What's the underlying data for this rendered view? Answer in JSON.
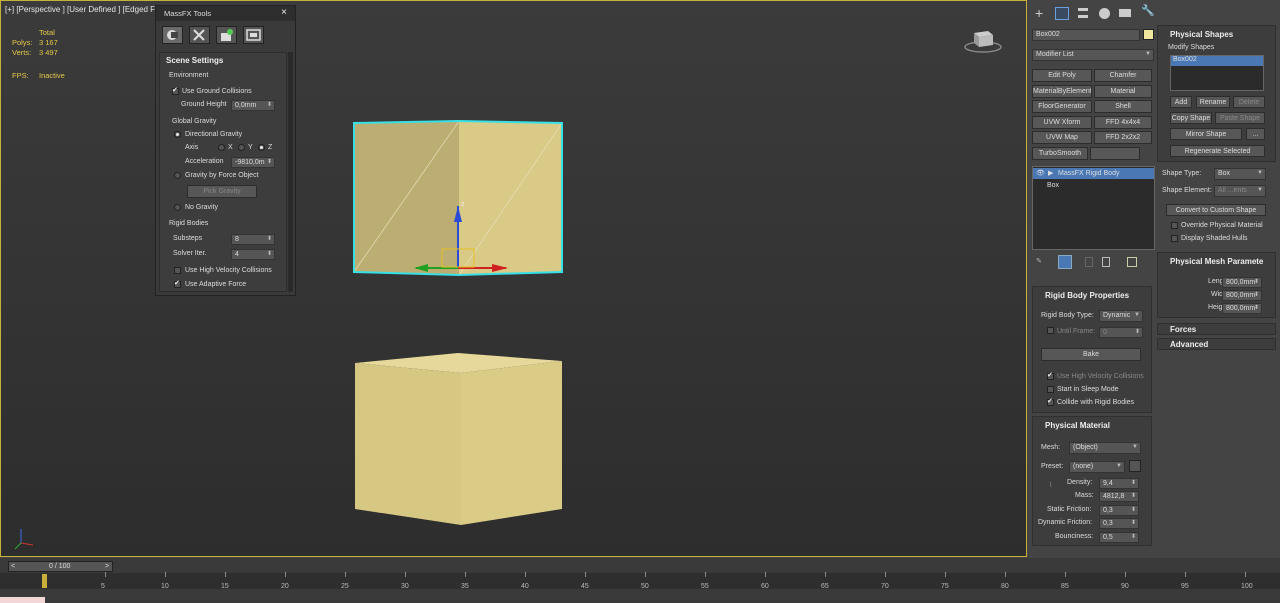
{
  "viewport": {
    "label": "[+] [Perspective ] [User Defined ] [Edged Fa",
    "stats": {
      "total_label": "Total",
      "polys_label": "Polys:",
      "polys_value": "3 167",
      "verts_label": "Verts:",
      "verts_value": "3 497",
      "fps_label": "FPS:",
      "fps_value": "Inactive"
    },
    "gizmo_axis_label": "z"
  },
  "massfx": {
    "title": "MassFX Tools",
    "close": "×",
    "tabs": [
      "world-icon",
      "tools-icon",
      "simulation-icon",
      "display-icon"
    ],
    "section": "Scene Settings",
    "environment_label": "Environment",
    "use_ground_collisions": "Use Ground Collisions",
    "ground_height_label": "Ground Height",
    "ground_height_value": "0,0mm",
    "global_gravity_label": "Global Gravity",
    "directional_gravity": "Directional Gravity",
    "axis_label": "Axis",
    "axis_x": "X",
    "axis_y": "Y",
    "axis_z": "Z",
    "acceleration_label": "Acceleration",
    "acceleration_value": "-9810,0m",
    "gravity_by_force": "Gravity by Force Object",
    "pick_gravity": "Pick Gravity",
    "no_gravity": "No Gravity",
    "rigid_bodies_label": "Rigid Bodies",
    "substeps_label": "Substeps",
    "substeps_value": "8",
    "solver_label": "Solver Iter.",
    "solver_value": "4",
    "high_velocity": "Use High Velocity Collisions",
    "adaptive_force": "Use Adaptive Force"
  },
  "cmd": {
    "object_name": "Box002",
    "modifier_list": "Modifier List",
    "mod_buttons": [
      "Edit Poly",
      "Chamfer",
      "MaterialByElement",
      "Material",
      "FloorGenerator",
      "Shell",
      "UVW Xform",
      "FFD 4x4x4",
      "UVW Map",
      "FFD 2x2x2",
      "TurboSmooth",
      ""
    ],
    "stack": [
      "MassFX Rigid Body",
      "Box"
    ],
    "rigid_body_props": "Rigid Body Properties",
    "rigid_body_type_label": "Rigid Body Type:",
    "rigid_body_type_value": "Dynamic",
    "until_frame_label": "Until Frame:",
    "until_frame_value": "0",
    "bake": "Bake",
    "use_high_velocity": "Use High Velocity Collisions",
    "start_sleep": "Start in Sleep Mode",
    "collide_rigid": "Collide with Rigid Bodies",
    "physical_material": "Physical Material",
    "mesh_label": "Mesh:",
    "mesh_value": "(Object)",
    "preset_label": "Preset:",
    "preset_value": "(none)",
    "density_label": "Density:",
    "density_value": "9,4",
    "mass_label": "Mass:",
    "mass_value": "4812,8",
    "static_friction_label": "Static Friction:",
    "static_friction_value": "0,3",
    "dynamic_friction_label": "Dynamic Friction:",
    "dynamic_friction_value": "0,3",
    "bounciness_label": "Bounciness:",
    "bounciness_value": "0,5",
    "physical_shapes": "Physical Shapes",
    "modify_shapes": "Modify Shapes",
    "shape_item": "Box002",
    "add": "Add",
    "rename": "Rename",
    "delete": "Delete",
    "copy_shape": "Copy Shape",
    "paste_shape": "Paste Shape",
    "mirror_shape": "Mirror Shape",
    "more": "...",
    "regenerate": "Regenerate Selected",
    "shape_type_label": "Shape Type:",
    "shape_type_value": "Box",
    "shape_element_label": "Shape Element:",
    "shape_element_value": "All ...ents",
    "convert_custom": "Convert to Custom Shape",
    "override_material": "Override Physical Material",
    "display_hulls": "Display Shaded Hulls",
    "mesh_params": "Physical Mesh Paramete",
    "length_label": "Length:",
    "length_value": "800,0mm",
    "width_label": "Width:",
    "width_value": "800,0mm",
    "height_label": "Height:",
    "height_value": "800,0mm",
    "forces": "Forces",
    "advanced": "Advanced"
  },
  "timeline": {
    "frame_counter": "0 / 100",
    "ticks": [
      "5",
      "10",
      "15",
      "20",
      "25",
      "30",
      "35",
      "40",
      "45",
      "50",
      "55",
      "60",
      "65",
      "70",
      "75",
      "80",
      "85",
      "90",
      "95",
      "100"
    ]
  },
  "colors": {
    "accent": "#c9b03a",
    "box": "#d8c985",
    "select": "#36e0e6",
    "list_highlight": "#4a78b5"
  }
}
